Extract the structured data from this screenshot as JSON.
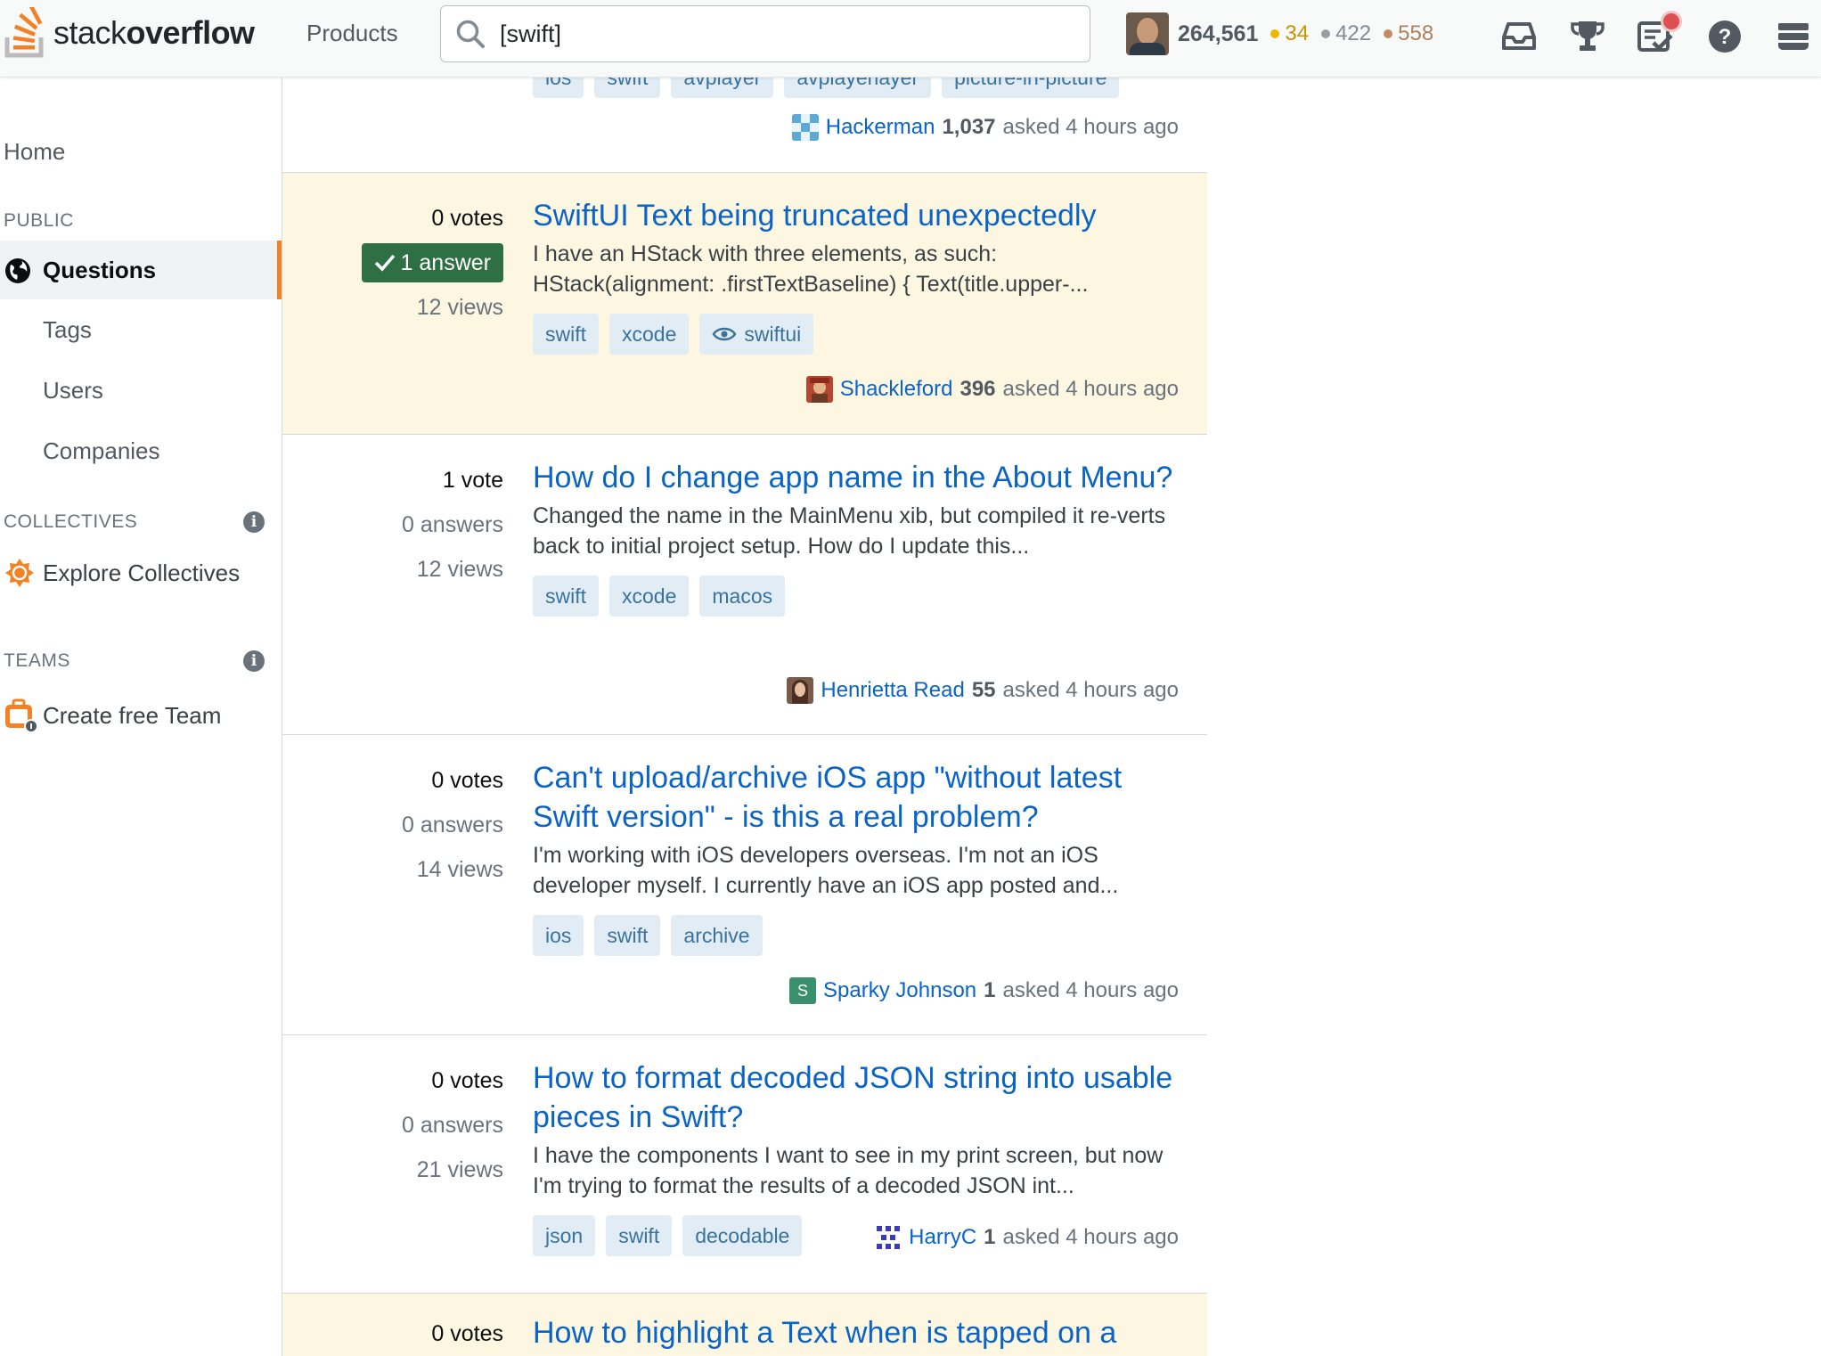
{
  "topbar": {
    "logo_thin": "stack",
    "logo_bold": "overflow",
    "products": "Products",
    "search_value": "[swift]",
    "reputation": "264,561",
    "badges": {
      "gold": "34",
      "silver": "422",
      "bronze": "558"
    },
    "colors": {
      "gold": "#f1b600",
      "silver": "#9a9fa5",
      "bronze": "#c38b5f",
      "accent": "#f48225"
    }
  },
  "sidebar": {
    "home": "Home",
    "public_heading": "PUBLIC",
    "questions": "Questions",
    "tags": "Tags",
    "users": "Users",
    "companies": "Companies",
    "collectives_heading": "COLLECTIVES",
    "explore_collectives": "Explore Collectives",
    "teams_heading": "TEAMS",
    "create_team": "Create free Team",
    "info_glyph": "i"
  },
  "prev_question": {
    "tags": [
      "ios",
      "swift",
      "avplayer",
      "avplayerlayer",
      "picture-in-picture"
    ],
    "user": "Hackerman",
    "rep": "1,037",
    "asked": "asked 4 hours ago"
  },
  "questions": [
    {
      "votes": "0 votes",
      "answers": "1 answer",
      "views": "12 views",
      "title": "SwiftUI Text being truncated unexpectedly",
      "excerpt": "I have an HStack with three elements, as such: HStack(alignment: .firstTextBaseline) { Text(title.upper-...",
      "tags": [
        "swift",
        "xcode",
        "swiftui"
      ],
      "user": "Shackleford",
      "rep": "396",
      "asked": "asked 4 hours ago"
    },
    {
      "votes": "1 vote",
      "answers": "0 answers",
      "views": "12 views",
      "title": "How do I change app name in the About Menu?",
      "excerpt": "Changed the name in the MainMenu xib, but compiled it re-verts back to initial project setup. How do I update this...",
      "tags": [
        "swift",
        "xcode",
        "macos"
      ],
      "user": "Henrietta Read",
      "rep": "55",
      "asked": "asked 4 hours ago"
    },
    {
      "votes": "0 votes",
      "answers": "0 answers",
      "views": "14 views",
      "title": "Can't upload/archive iOS app \"without latest Swift version\" - is this a real problem?",
      "excerpt": "I'm working with iOS developers overseas. I'm not an iOS developer myself. I currently have an iOS app posted and...",
      "tags": [
        "ios",
        "swift",
        "archive"
      ],
      "user": "Sparky Johnson",
      "avatar_letter": "S",
      "rep": "1",
      "asked": "asked 4 hours ago"
    },
    {
      "votes": "0 votes",
      "answers": "0 answers",
      "views": "21 views",
      "title": "How to format decoded JSON string into usable pieces in Swift?",
      "excerpt": "I have the components I want to see in my print screen, but now I'm trying to format the results of a decoded JSON int...",
      "tags": [
        "json",
        "swift",
        "decodable"
      ],
      "user": "HarryC",
      "rep": "1",
      "asked": "asked 4 hours ago"
    },
    {
      "votes": "0 votes",
      "title": "How to highlight a Text when is tapped on a"
    }
  ]
}
